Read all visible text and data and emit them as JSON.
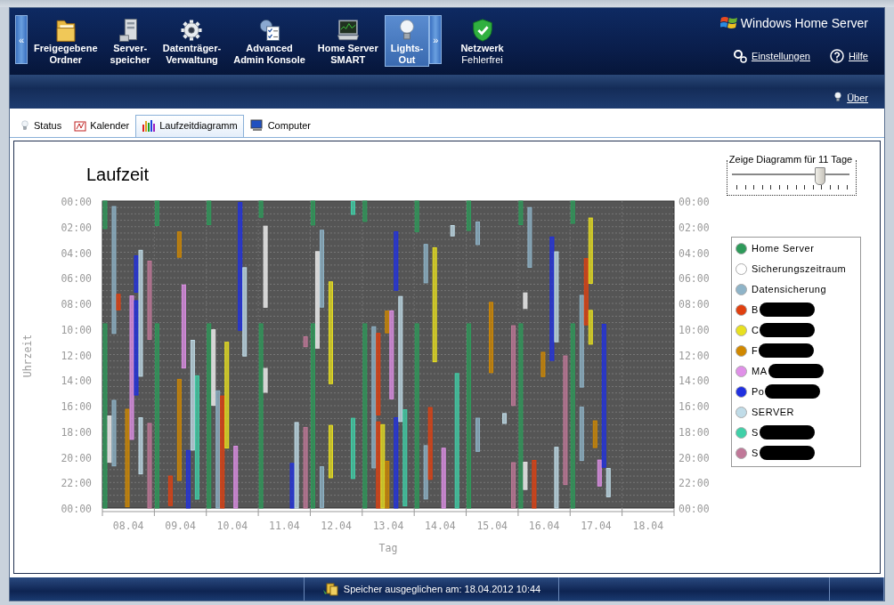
{
  "nav": {
    "scroll_left": "«",
    "scroll_right": "»",
    "items": [
      {
        "label": "Freigegebene\nOrdner",
        "kind": "folder",
        "selected": false
      },
      {
        "label": "Server-\nspeicher",
        "kind": "server",
        "selected": false
      },
      {
        "label": "Datenträger-\nVerwaltung",
        "kind": "gear",
        "selected": false
      },
      {
        "label": "Advanced\nAdmin Konsole",
        "kind": "checklist",
        "selected": false
      },
      {
        "label": "Home Server\nSMART",
        "kind": "monitor",
        "selected": false
      },
      {
        "label": "Lights-\nOut",
        "kind": "bulb",
        "selected": true
      }
    ],
    "network": {
      "title": "Netzwerk",
      "detail": "Fehlerfrei"
    },
    "brand": "Windows Home Server",
    "links": [
      {
        "label": "Einstellungen",
        "kind": "settings"
      },
      {
        "label": "Hilfe",
        "kind": "help"
      }
    ],
    "about": "Über"
  },
  "tabs": [
    {
      "label": "Status",
      "kind": "bulb",
      "selected": false
    },
    {
      "label": "Kalender",
      "kind": "calendar",
      "selected": false
    },
    {
      "label": "Laufzeitdiagramm",
      "kind": "barchart",
      "selected": true
    },
    {
      "label": "Computer",
      "kind": "computer",
      "selected": false
    }
  ],
  "chart": {
    "title": "Laufzeit",
    "ylabel": "Uhrzeit",
    "xlabel": "Tag",
    "yticks_left": [
      "00:00",
      "02:00",
      "04:00",
      "06:00",
      "08:00",
      "10:00",
      "12:00",
      "14:00",
      "16:00",
      "18:00",
      "20:00",
      "22:00",
      "00:00"
    ],
    "yticks_right": [
      "00:00",
      "02:00",
      "04:00",
      "06:00",
      "08:00",
      "10:00",
      "12:00",
      "14:00",
      "16:00",
      "18:00",
      "20:00",
      "22:00",
      "00:00"
    ],
    "days": [
      "08.04",
      "09.04",
      "10.04",
      "11.04",
      "12.04",
      "13.04",
      "14.04",
      "15.04",
      "16.04",
      "17.04",
      "18.04"
    ]
  },
  "range_slider": {
    "label": "Zeige Diagramm für 11 Tage",
    "level": 0.74
  },
  "legend": [
    {
      "name": "Home Server",
      "color": "#2e9a5a",
      "redacted": false
    },
    {
      "name": "Sicherungszeitraum",
      "color": "#ffffff",
      "redacted": false
    },
    {
      "name": "Datensicherung",
      "color": "#8fb4c8",
      "redacted": false
    },
    {
      "name": "B",
      "color": "#e04010",
      "redacted": true
    },
    {
      "name": "C",
      "color": "#e8e020",
      "redacted": true
    },
    {
      "name": "F",
      "color": "#d08800",
      "redacted": true
    },
    {
      "name": "MA",
      "color": "#e090e8",
      "redacted": true
    },
    {
      "name": "Po",
      "color": "#2030e0",
      "redacted": true
    },
    {
      "name": "SERVER",
      "color": "#c0dce8",
      "redacted": false
    },
    {
      "name": "S",
      "color": "#40d0a8",
      "redacted": true
    },
    {
      "name": "S",
      "color": "#c07898",
      "redacted": true
    }
  ],
  "status_bar": "Speicher ausgeglichen am: 18.04.2012 10:44"
}
